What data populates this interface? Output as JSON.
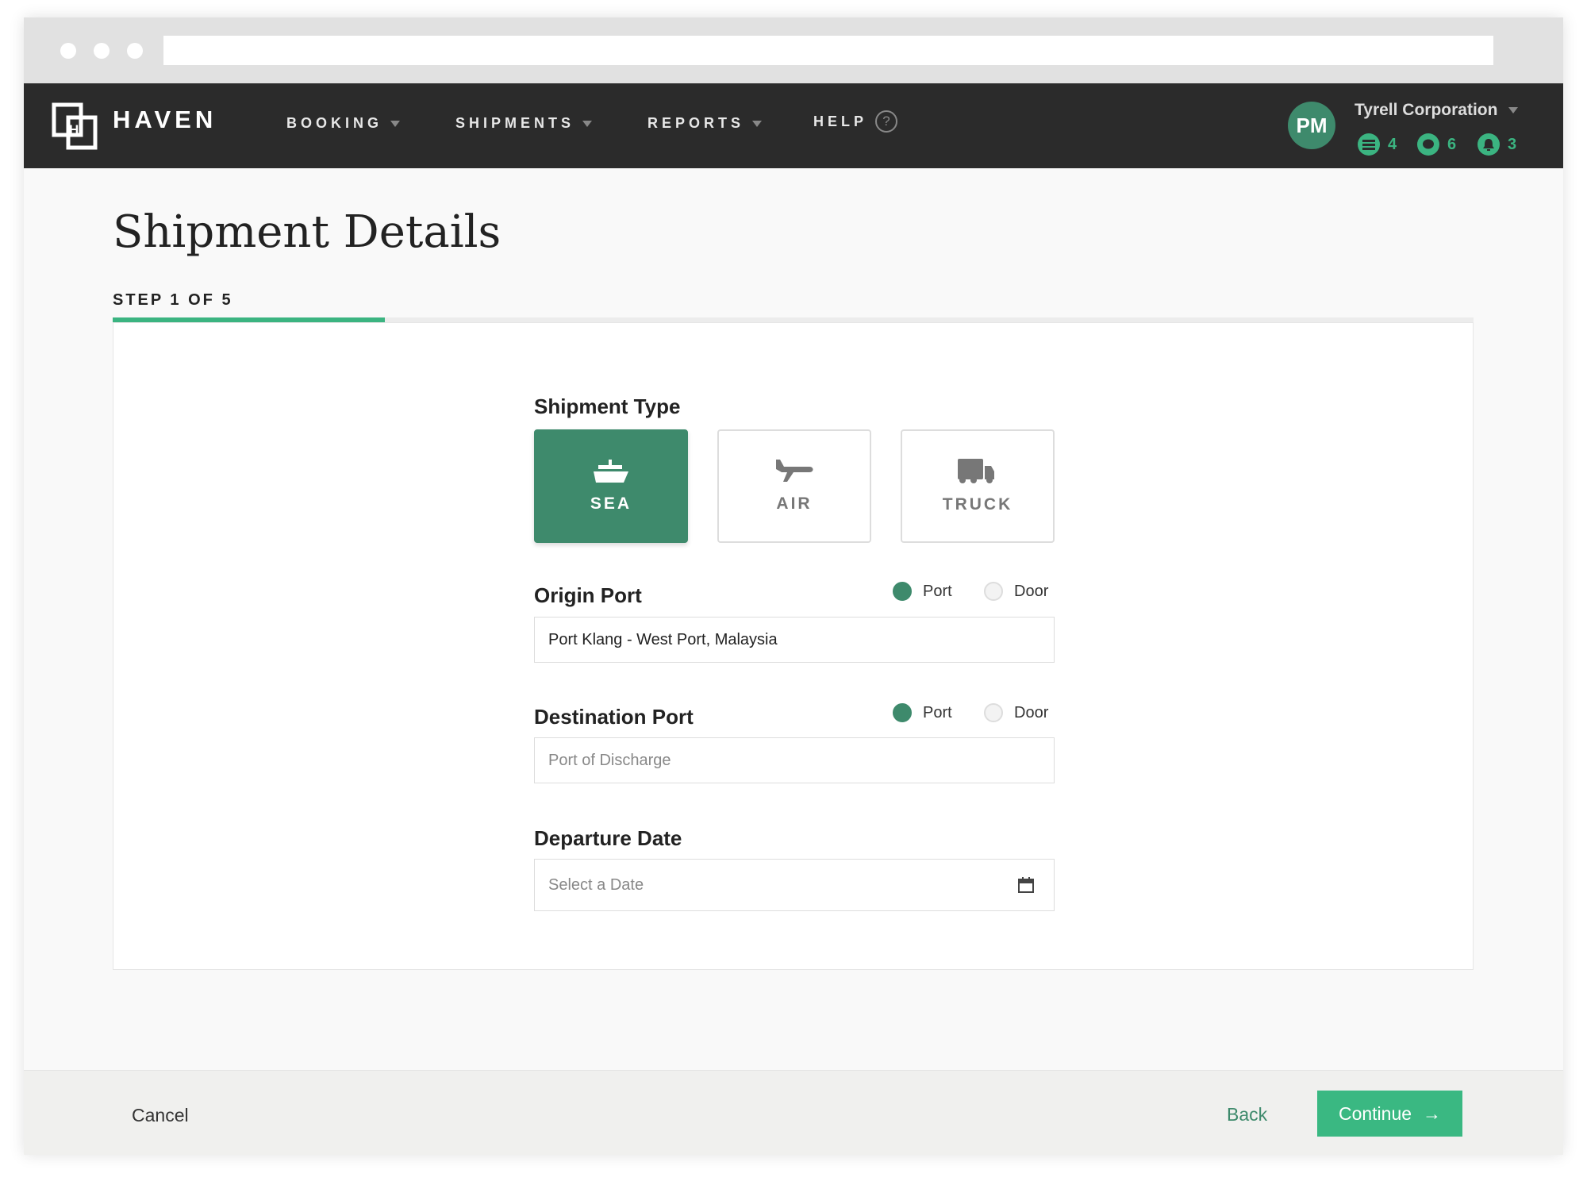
{
  "nav": {
    "brand": "HAVEN",
    "items": [
      {
        "label": "BOOKING"
      },
      {
        "label": "SHIPMENTS"
      },
      {
        "label": "REPORTS"
      },
      {
        "label": "HELP"
      }
    ],
    "user_initials": "PM",
    "organization": "Tyrell Corporation",
    "counts": {
      "tasks": "4",
      "messages": "6",
      "notifications": "3"
    }
  },
  "page": {
    "title": "Shipment Details",
    "step": "STEP 1 OF 5",
    "progress_fraction": 0.2
  },
  "form": {
    "shipment_type": {
      "label": "Shipment Type",
      "options": [
        "SEA",
        "AIR",
        "TRUCK"
      ],
      "selected": "SEA"
    },
    "origin": {
      "label": "Origin Port",
      "radio_port": "Port",
      "radio_door": "Door",
      "selected": "Port",
      "value": "Port Klang - West Port, Malaysia"
    },
    "destination": {
      "label": "Destination Port",
      "radio_port": "Port",
      "radio_door": "Door",
      "selected": "Port",
      "placeholder": "Port of Discharge"
    },
    "departure": {
      "label": "Departure Date",
      "placeholder": "Select a Date"
    }
  },
  "footer": {
    "cancel": "Cancel",
    "back": "Back",
    "continue": "Continue"
  },
  "colors": {
    "nav_bg": "#2b2b2b",
    "primary": "#3e8a6c",
    "accent": "#3bb481",
    "continue_bg": "#3ab882"
  }
}
